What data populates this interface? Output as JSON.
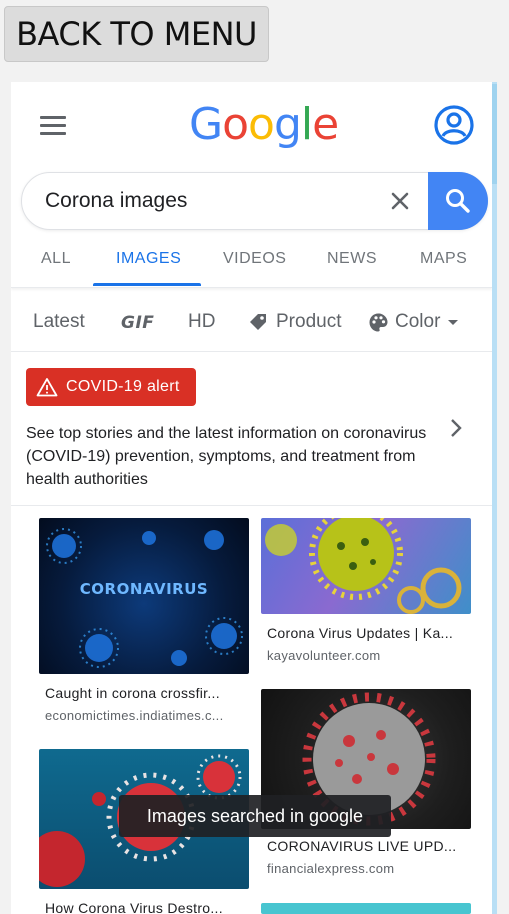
{
  "back_button": {
    "label": "BACK TO MENU"
  },
  "header": {
    "logo_letters": [
      {
        "ch": "G",
        "color": "#4285F4"
      },
      {
        "ch": "o",
        "color": "#EA4335"
      },
      {
        "ch": "o",
        "color": "#FBBC05"
      },
      {
        "ch": "g",
        "color": "#4285F4"
      },
      {
        "ch": "l",
        "color": "#34A853"
      },
      {
        "ch": "e",
        "color": "#EA4335"
      }
    ]
  },
  "search": {
    "query": "Corona images"
  },
  "tabs": [
    {
      "label": "ALL",
      "active": false
    },
    {
      "label": "IMAGES",
      "active": true
    },
    {
      "label": "VIDEOS",
      "active": false
    },
    {
      "label": "NEWS",
      "active": false
    },
    {
      "label": "MAPS",
      "active": false
    }
  ],
  "filters": {
    "latest": "Latest",
    "gif": "GIF",
    "hd": "HD",
    "product": "Product",
    "color": "Color"
  },
  "covid_alert": {
    "badge": "COVID-19 alert",
    "text": "See top stories and the latest information on coronavirus (COVID-19) prevention, symptoms, and treatment from health authorities"
  },
  "results": [
    {
      "title": "Caught in corona crossfir...",
      "source": "economictimes.indiatimes.c...",
      "image_text": "CORONAVIRUS"
    },
    {
      "title": "Corona Virus Updates | Ka...",
      "source": "kayavolunteer.com"
    },
    {
      "title": "CORONAVIRUS LIVE UPD...",
      "source": "financialexpress.com"
    },
    {
      "title": "How Corona Virus Destro..."
    }
  ],
  "toast": "Images searched in google",
  "colors": {
    "accent": "#1a73e8",
    "alert": "#d93025",
    "search_button": "#4285f4"
  }
}
